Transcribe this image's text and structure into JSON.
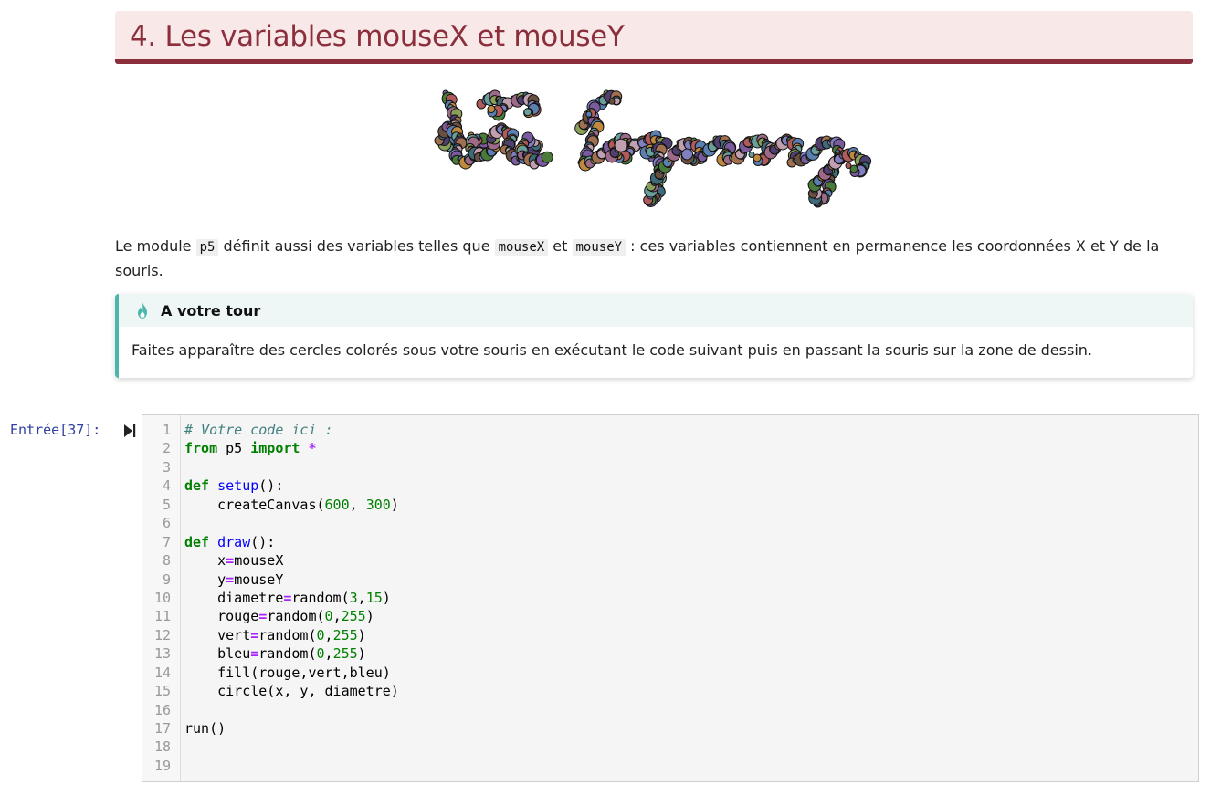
{
  "heading": {
    "title": "4. Les variables mouseX et mouseY"
  },
  "paragraph": {
    "t1": "Le module ",
    "c1": "p5",
    "t2": " définit aussi des variables telles que ",
    "c2": "mouseX",
    "t3": " et ",
    "c3": "mouseY",
    "t4": " : ces variables contiennent en permanence les coordonnées X et Y de la souris."
  },
  "admonition": {
    "icon": "flame-icon",
    "title": "A votre tour",
    "body": "Faites apparaître des cercles colorés sous votre souris en exécutant le code suivant puis en passant la souris sur la zone de dessin."
  },
  "cell": {
    "prompt": "Entrée[37]:",
    "run_icon": "run-cell-icon",
    "lines": [
      {
        "n": "1",
        "tokens": [
          {
            "c": "cm",
            "t": "# Votre code ici :"
          }
        ]
      },
      {
        "n": "2",
        "tokens": [
          {
            "c": "kw",
            "t": "from"
          },
          {
            "c": "nm",
            "t": " p5 "
          },
          {
            "c": "kw",
            "t": "import"
          },
          {
            "c": "nm",
            "t": " "
          },
          {
            "c": "op",
            "t": "*"
          }
        ]
      },
      {
        "n": "3",
        "tokens": []
      },
      {
        "n": "4",
        "tokens": [
          {
            "c": "kw",
            "t": "def"
          },
          {
            "c": "nm",
            "t": " "
          },
          {
            "c": "fn",
            "t": "setup"
          },
          {
            "c": "nm",
            "t": "():"
          }
        ]
      },
      {
        "n": "5",
        "tokens": [
          {
            "c": "nm",
            "t": "    createCanvas("
          },
          {
            "c": "num",
            "t": "600"
          },
          {
            "c": "nm",
            "t": ", "
          },
          {
            "c": "num",
            "t": "300"
          },
          {
            "c": "nm",
            "t": ")"
          }
        ]
      },
      {
        "n": "6",
        "tokens": []
      },
      {
        "n": "7",
        "tokens": [
          {
            "c": "kw",
            "t": "def"
          },
          {
            "c": "nm",
            "t": " "
          },
          {
            "c": "fn",
            "t": "draw"
          },
          {
            "c": "nm",
            "t": "():"
          }
        ]
      },
      {
        "n": "8",
        "tokens": [
          {
            "c": "nm",
            "t": "    x"
          },
          {
            "c": "op",
            "t": "="
          },
          {
            "c": "nm",
            "t": "mouseX"
          }
        ]
      },
      {
        "n": "9",
        "tokens": [
          {
            "c": "nm",
            "t": "    y"
          },
          {
            "c": "op",
            "t": "="
          },
          {
            "c": "nm",
            "t": "mouseY"
          }
        ]
      },
      {
        "n": "10",
        "tokens": [
          {
            "c": "nm",
            "t": "    diametre"
          },
          {
            "c": "op",
            "t": "="
          },
          {
            "c": "nm",
            "t": "random("
          },
          {
            "c": "num",
            "t": "3"
          },
          {
            "c": "nm",
            "t": ","
          },
          {
            "c": "num",
            "t": "15"
          },
          {
            "c": "nm",
            "t": ")"
          }
        ]
      },
      {
        "n": "11",
        "tokens": [
          {
            "c": "nm",
            "t": "    rouge"
          },
          {
            "c": "op",
            "t": "="
          },
          {
            "c": "nm",
            "t": "random("
          },
          {
            "c": "num",
            "t": "0"
          },
          {
            "c": "nm",
            "t": ","
          },
          {
            "c": "num",
            "t": "255"
          },
          {
            "c": "nm",
            "t": ")"
          }
        ]
      },
      {
        "n": "12",
        "tokens": [
          {
            "c": "nm",
            "t": "    vert"
          },
          {
            "c": "op",
            "t": "="
          },
          {
            "c": "nm",
            "t": "random("
          },
          {
            "c": "num",
            "t": "0"
          },
          {
            "c": "nm",
            "t": ","
          },
          {
            "c": "num",
            "t": "255"
          },
          {
            "c": "nm",
            "t": ")"
          }
        ]
      },
      {
        "n": "13",
        "tokens": [
          {
            "c": "nm",
            "t": "    bleu"
          },
          {
            "c": "op",
            "t": "="
          },
          {
            "c": "nm",
            "t": "random("
          },
          {
            "c": "num",
            "t": "0"
          },
          {
            "c": "nm",
            "t": ","
          },
          {
            "c": "num",
            "t": "255"
          },
          {
            "c": "nm",
            "t": ")"
          }
        ]
      },
      {
        "n": "14",
        "tokens": [
          {
            "c": "nm",
            "t": "    fill(rouge,vert,bleu)"
          }
        ]
      },
      {
        "n": "15",
        "tokens": [
          {
            "c": "nm",
            "t": "    circle(x, y, diametre)"
          }
        ]
      },
      {
        "n": "16",
        "tokens": []
      },
      {
        "n": "17",
        "tokens": [
          {
            "c": "nm",
            "t": "run()"
          }
        ]
      },
      {
        "n": "18",
        "tokens": []
      },
      {
        "n": "19",
        "tokens": []
      }
    ]
  },
  "colors": {
    "heading_accent": "#8b2f3d",
    "heading_bg": "#f9e8e8",
    "admonition_accent": "#4db6ac",
    "prompt": "#303f9f"
  },
  "illustration": {
    "name": "colored-circle-handwriting-image"
  }
}
